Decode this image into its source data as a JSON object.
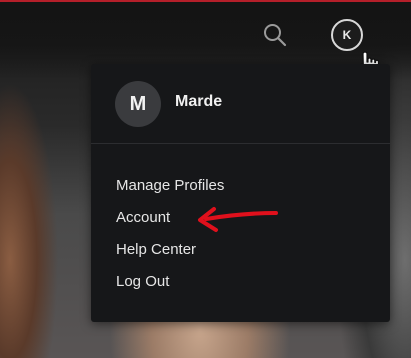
{
  "header": {
    "search_icon": "search-icon",
    "account_initial": "K"
  },
  "profile_menu": {
    "profile": {
      "initial": "M",
      "name": "Marde"
    },
    "items": [
      {
        "label": "Manage Profiles"
      },
      {
        "label": "Account"
      },
      {
        "label": "Help Center"
      },
      {
        "label": "Log Out"
      }
    ]
  },
  "annotation": {
    "arrow_color": "#e0101c",
    "points_to": "Account"
  },
  "colors": {
    "menu_background": "#161719",
    "brand_red": "#b51f2a"
  }
}
